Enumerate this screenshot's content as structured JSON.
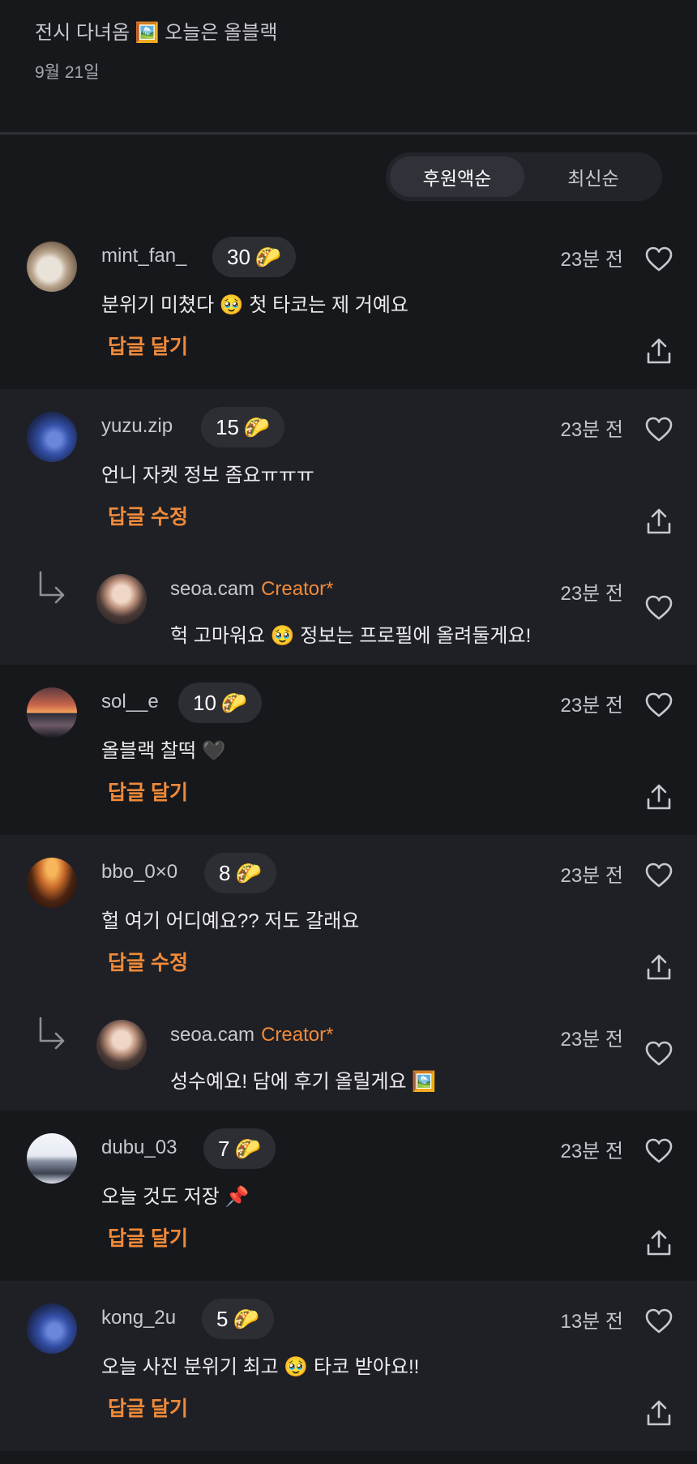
{
  "post": {
    "title": "전시 다녀옴 🖼️  오늘은 올블랙",
    "date": "9월 21일"
  },
  "sort": {
    "options": [
      "후원액순",
      "최신순"
    ],
    "selected": "후원액순"
  },
  "colors": {
    "accent_orange": "#f08a3a",
    "bg_dark": "#17181c",
    "bg_light": "#1f2025",
    "badge_bg": "#2c2e34"
  },
  "threads": [
    {
      "shade": "dark",
      "comment": {
        "username": "mint_fan_",
        "tip": "30",
        "tip_icon": "🌮",
        "time": "23분 전",
        "text": "분위기 미쳤다 🥹  첫 타코는 제 거예요",
        "action": "답글 달기",
        "avatar": "cat-photo"
      }
    },
    {
      "shade": "light",
      "comment": {
        "username": "yuzu.zip",
        "tip": "15",
        "tip_icon": "🌮",
        "time": "23분 전",
        "text": "언니 자켓 정보 좀요ㅠㅠㅠ",
        "action": "답글 수정",
        "avatar": "blue-flower-photo"
      },
      "reply": {
        "username": "seoa.cam",
        "badge": "Creator*",
        "time": "23분 전",
        "text": "헉 고마워요 🥹  정보는 프로필에 올려둘게요!",
        "avatar": "creator-portrait"
      }
    },
    {
      "shade": "dark",
      "comment": {
        "username": "sol__e",
        "tip": "10",
        "tip_icon": "🌮",
        "time": "23분 전",
        "text": "올블랙 찰떡 🖤",
        "action": "답글 달기",
        "avatar": "sunset-photo"
      }
    },
    {
      "shade": "light",
      "comment": {
        "username": "bbo_0×0",
        "tip": "8",
        "tip_icon": "🌮",
        "time": "23분 전",
        "text": "헐 여기 어디예요?? 저도 갈래요",
        "action": "답글 수정",
        "avatar": "city-lights-photo"
      },
      "reply": {
        "username": "seoa.cam",
        "badge": "Creator*",
        "time": "23분 전",
        "text": "성수예요! 담에 후기 올릴게요 🖼️",
        "avatar": "creator-portrait"
      }
    },
    {
      "shade": "dark",
      "comment": {
        "username": "dubu_03",
        "tip": "7",
        "tip_icon": "🌮",
        "time": "23분 전",
        "text": "오늘 것도 저장 📌",
        "action": "답글 달기",
        "avatar": "snow-mountain-photo"
      }
    },
    {
      "shade": "light",
      "comment": {
        "username": "kong_2u",
        "tip": "5",
        "tip_icon": "🌮",
        "time": "13분 전",
        "text": "오늘 사진 분위기 최고 🥹  타코 받아요!!",
        "action": "답글 달기",
        "avatar": "blue-flower-photo"
      }
    }
  ]
}
